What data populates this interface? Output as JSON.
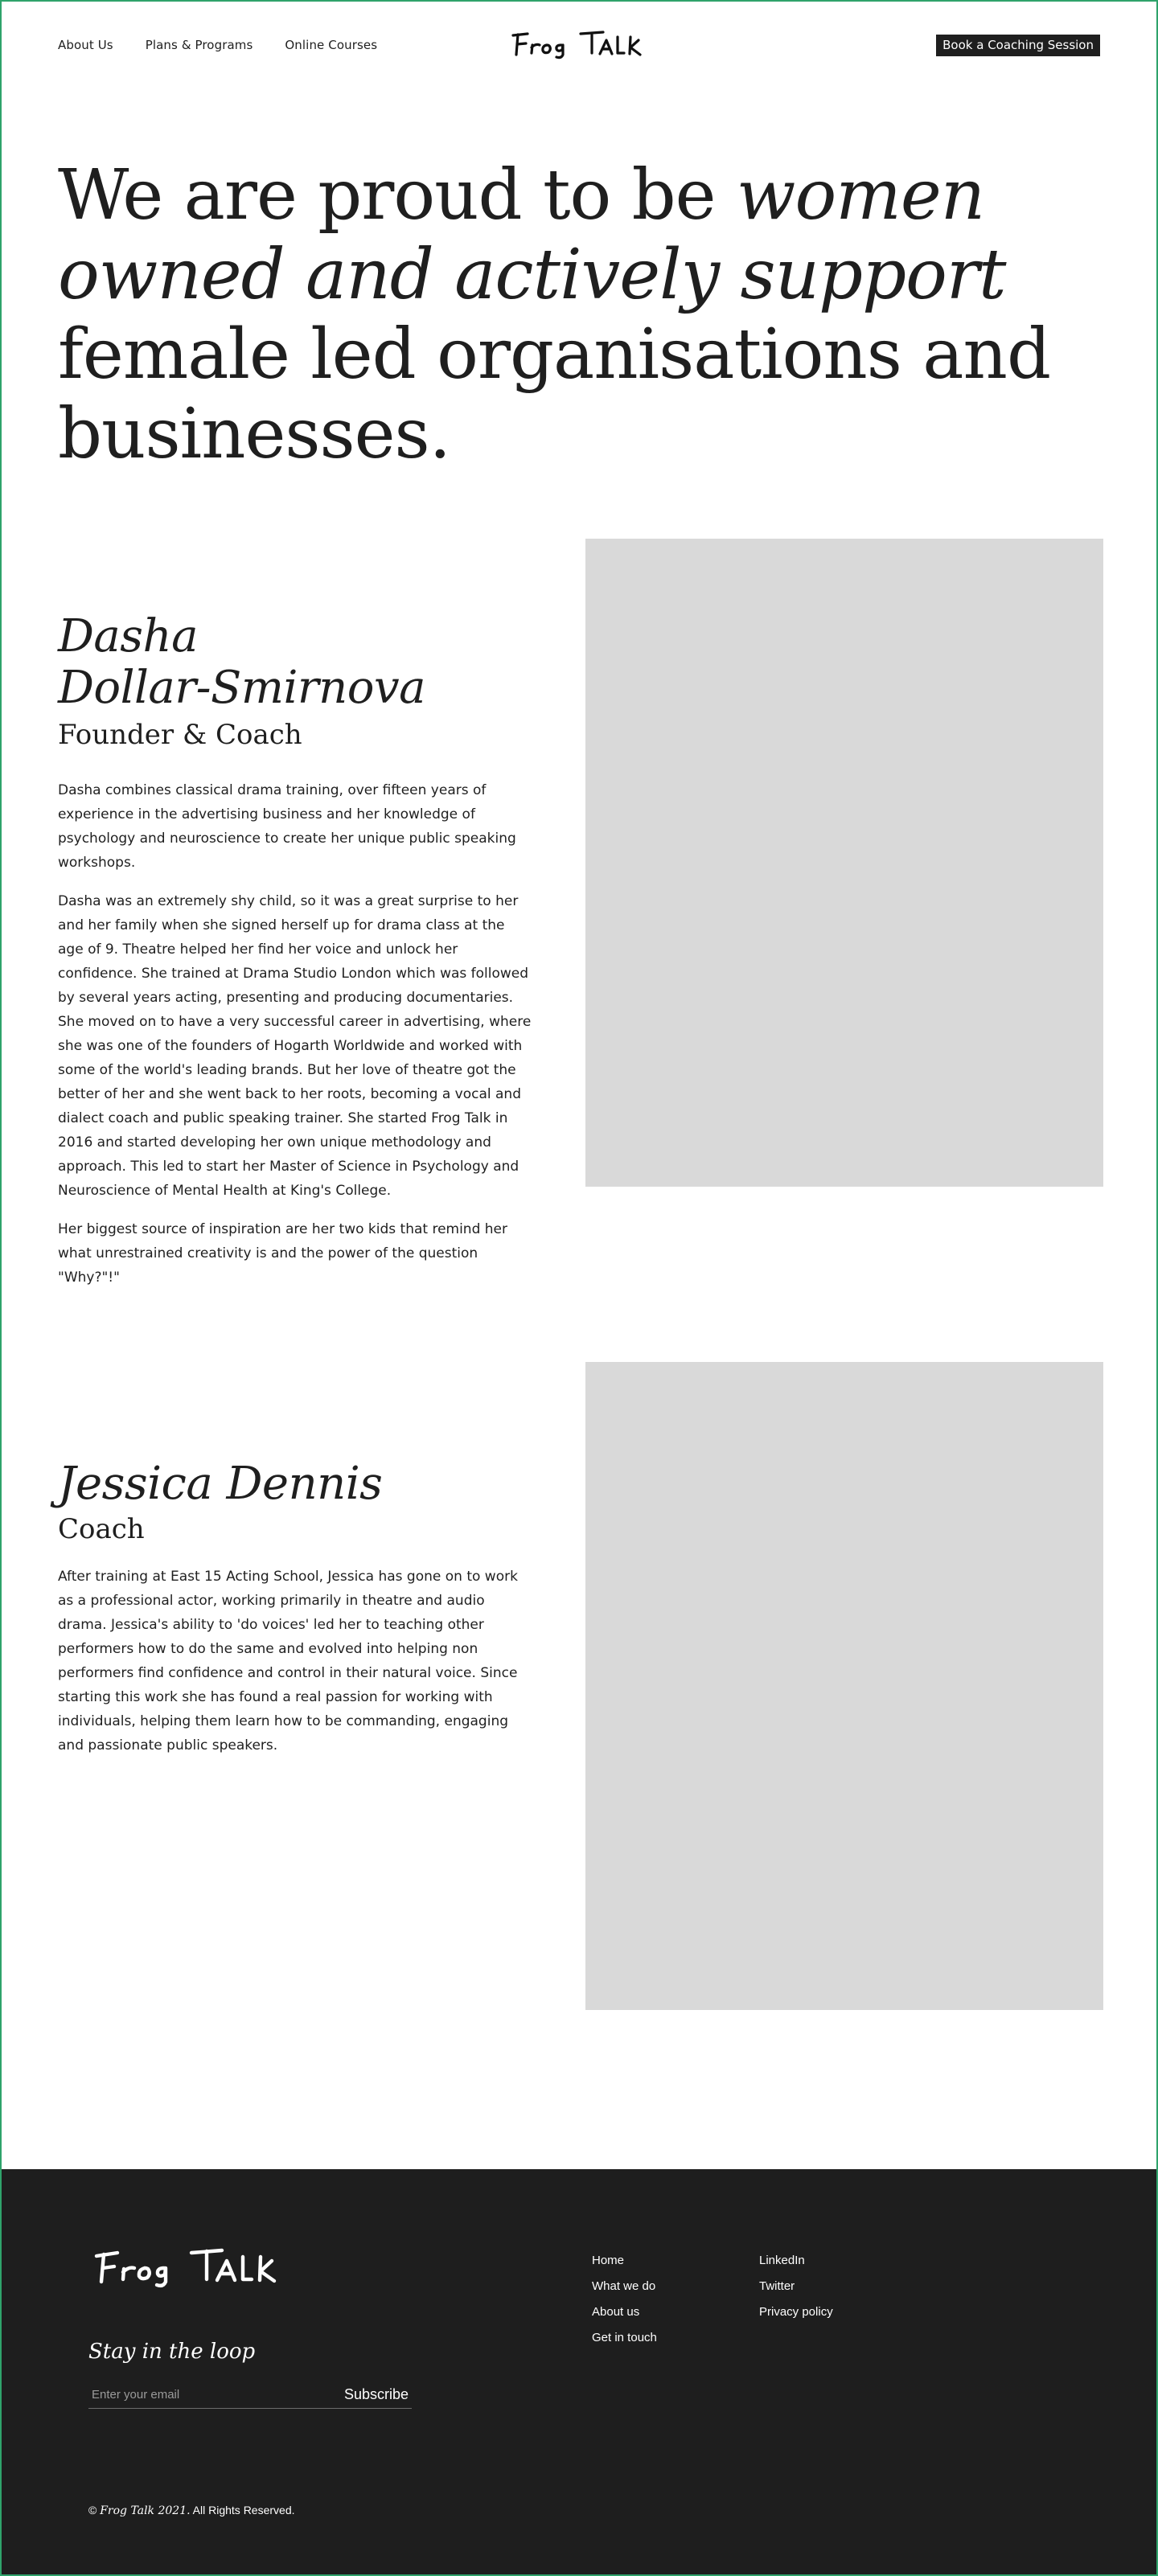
{
  "nav": {
    "links": [
      "About Us",
      "Plans & Programs",
      "Online Courses"
    ],
    "logo_text": "Frog Talk",
    "cta_label": "Book a Coaching Session"
  },
  "hero": {
    "part1": "We are proud to be ",
    "part2_italic": "women owned and actively support",
    "part3": " female led organisations and businesses."
  },
  "people": [
    {
      "name": "Dasha Dollar-Smirnova",
      "name_line1": "Dasha",
      "name_line2": "Dollar-Smirnova",
      "role": "Founder & Coach",
      "bio": [
        "Dasha combines classical drama training, over fifteen years of experience in the advertising business and her knowledge of psychology and neuroscience to create her unique public speaking workshops.",
        "Dasha was an extremely shy child, so it was a great surprise to her and her family when she signed herself up for drama class at the age of 9. Theatre helped her find her voice and unlock her confidence. She trained at Drama Studio London which was followed by several years acting, presenting and producing documentaries. She moved on to have a very successful career in advertising, where she was one of the founders of Hogarth Worldwide and worked with some of the world's leading brands. But her love of theatre got the better of her and she went back to her roots, becoming a vocal and dialect coach and public speaking trainer. She started Frog Talk in 2016 and started developing her own unique methodology and approach. This led to start her Master of Science in Psychology and Neuroscience of Mental Health at King's College.",
        "Her biggest source of inspiration are her two kids that remind her what unrestrained creativity is and the power of the question \"Why?\"!\""
      ]
    },
    {
      "name": "Jessica Dennis",
      "role": "Coach",
      "bio": [
        "After training at East 15 Acting School, Jessica has gone on to work as a professional actor, working primarily in theatre and audio drama. Jessica's ability to 'do voices' led her to teaching other performers how to do the same and evolved into helping non performers find confidence and control in their natural voice. Since starting this work she has found a real passion for working with individuals, helping them learn how to be commanding, engaging and passionate public speakers."
      ]
    }
  ],
  "footer": {
    "logo_text": "Frog Talk",
    "newsletter_title": "Stay in the loop",
    "email_placeholder": "Enter your email",
    "subscribe_label": "Subscribe",
    "col1": [
      "Home",
      "What we do",
      "About us",
      "Get in touch"
    ],
    "col2": [
      "LinkedIn",
      "Twitter",
      "Privacy policy"
    ],
    "copyright_prefix": "© ",
    "copyright_brand": "Frog Talk 2021.",
    "copyright_suffix": " All Rights Reserved."
  },
  "colors": {
    "text": "#1f1f1f",
    "photo_placeholder": "#d9d9d9",
    "footer_bg": "#1e1e1e",
    "frame_border": "#2fa36b"
  }
}
